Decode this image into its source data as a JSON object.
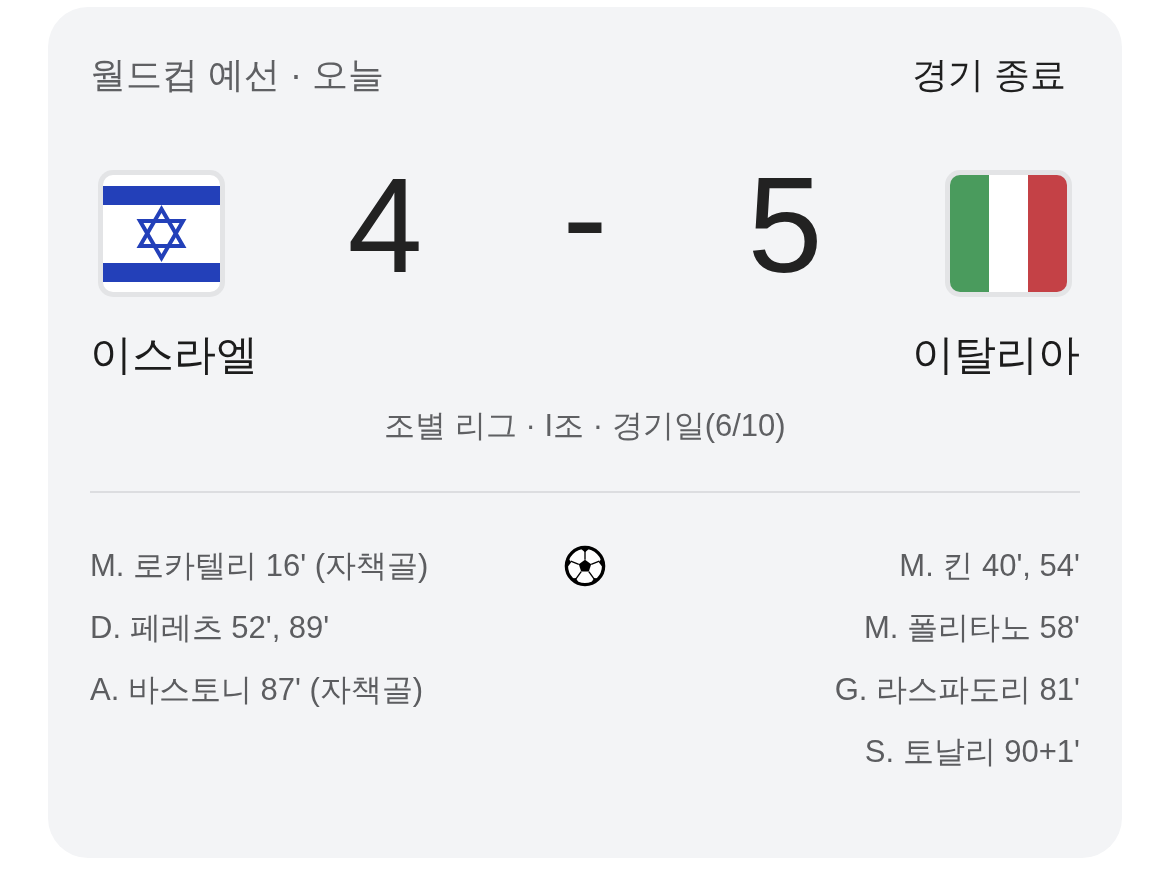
{
  "header": {
    "title": "월드컵 예선 · 오늘",
    "status": "경기 종료"
  },
  "teams": [
    {
      "kind": "israel",
      "name": "이스라엘",
      "score": "4"
    },
    {
      "kind": "italy",
      "name": "이탈리아",
      "score": "5"
    }
  ],
  "score_separator": "-",
  "round_info": "조별 리그 · I조 · 경기일(6/10)",
  "goals": {
    "home": [
      "M. 로카텔리 16' (자책골)",
      "D. 페레츠 52', 89'",
      "A. 바스토니 87' (자책골)"
    ],
    "away": [
      "M. 킨 40', 54'",
      "M. 폴리타노 58'",
      "G. 라스파도리 81'",
      "S. 토날리 90+1'"
    ]
  }
}
